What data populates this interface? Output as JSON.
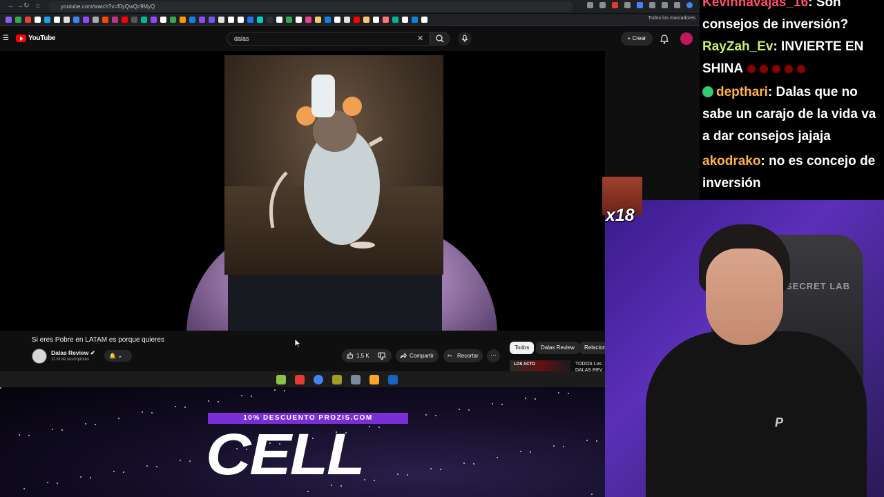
{
  "browser": {
    "url": "youtube.com/watch?v=f0yQwQc9MyQ",
    "bookmarks_folder": "Todos los marcadores",
    "bookmark_colors": [
      "#8b5cf6",
      "#34a853",
      "#ea4335",
      "#ffffff",
      "#1da1f2",
      "#ffffff",
      "#e0e0e0",
      "#4285f4",
      "#9146ff",
      "#aaaaaa",
      "#ff4500",
      "#c13584",
      "#ff0000",
      "#555555",
      "#00b894",
      "#9146ff",
      "#ffffff",
      "#34a853",
      "#ff9800",
      "#0984e3",
      "#9146ff",
      "#6c5ce7",
      "#e0e0e0",
      "#ffffff",
      "#ffffff",
      "#1877f2",
      "#00cec9",
      "#2d3436",
      "#ffffff",
      "#34a853",
      "#ffffff",
      "#e84393",
      "#fdcb6e",
      "#0984e3",
      "#ffffff",
      "#e0e0e0",
      "#ff0000",
      "#fdcb6e",
      "#ffffff",
      "#ff7675",
      "#00b894",
      "#ffffff",
      "#0984e3",
      "#ffffff"
    ]
  },
  "youtube": {
    "logo_text": "YouTube",
    "search_value": "dalas",
    "create_label": "Crear",
    "video_title": "Si eres Pobre en LATAM es porque quieres",
    "channel_name": "Dalas Review",
    "channel_subs": "11 M de suscriptores",
    "like_count": "1,5 K",
    "share_label": "Compartir",
    "clip_label": "Recortar",
    "chips": [
      {
        "label": "Todos",
        "active": true
      },
      {
        "label": "Dalas Review",
        "active": false
      },
      {
        "label": "Relacion",
        "active": false
      }
    ],
    "related_thumb_text": "LOS ACTO",
    "related_title": "TODOS Los DALAS REV"
  },
  "taskbar_icons": [
    "#8bc34a",
    "#e53935",
    "#4285f4",
    "#9e9d24",
    "#7b8ba1",
    "#f9a825",
    "#1565c0"
  ],
  "sponsor": {
    "promo_text": "10% DESCUENTO PROZIS.COM",
    "product_text": "CELL"
  },
  "chat": [
    {
      "user": "Kevinnavajas_16",
      "user_color": "#ff4d6d",
      "message": ": Son consejos de inversión?",
      "badge": false,
      "emotes": 0
    },
    {
      "user": "RayZah_Ev",
      "user_color": "#c7f36b",
      "message": ": INVIERTE EN SHINA",
      "badge": false,
      "emotes": 5
    },
    {
      "user": "depthari",
      "user_color": "#ffb347",
      "message": ": Dalas que no sabe un carajo de la vida va a dar consejos jajaja",
      "badge": true,
      "emotes": 0
    },
    {
      "user": "akodrako",
      "user_color": "#ffb347",
      "message": ": no es concejo de inversión",
      "badge": false,
      "emotes": 0
    }
  ],
  "emote_combo": {
    "count": "x18"
  },
  "webcam": {
    "chair_brand": "SECRET LAB",
    "shirt_logo": "P"
  }
}
